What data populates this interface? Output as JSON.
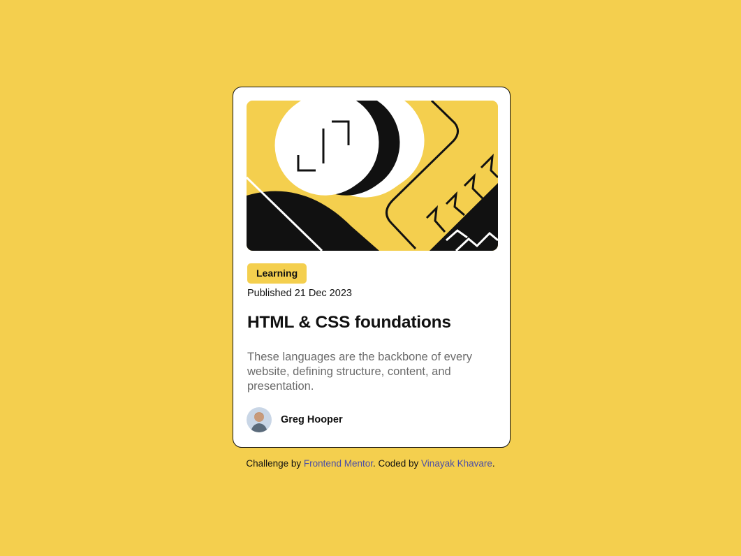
{
  "card": {
    "tag": "Learning",
    "published": "Published 21 Dec 2023",
    "title": "HTML & CSS foundations",
    "description": "These languages are the backbone of every website, defining structure, content, and presentation.",
    "author": "Greg Hooper"
  },
  "footer": {
    "challenge_prefix": "Challenge by",
    "challenge_link": "Frontend Mentor",
    "coded_by_prefix": ". Coded by",
    "coded_by_link": "Vinayak Khavare",
    "suffix": "."
  },
  "colors": {
    "background": "#F4CF4E",
    "card": "#FFFFFF",
    "text": "#111111",
    "muted": "#6B6B6B",
    "link": "#4B4EA6"
  }
}
